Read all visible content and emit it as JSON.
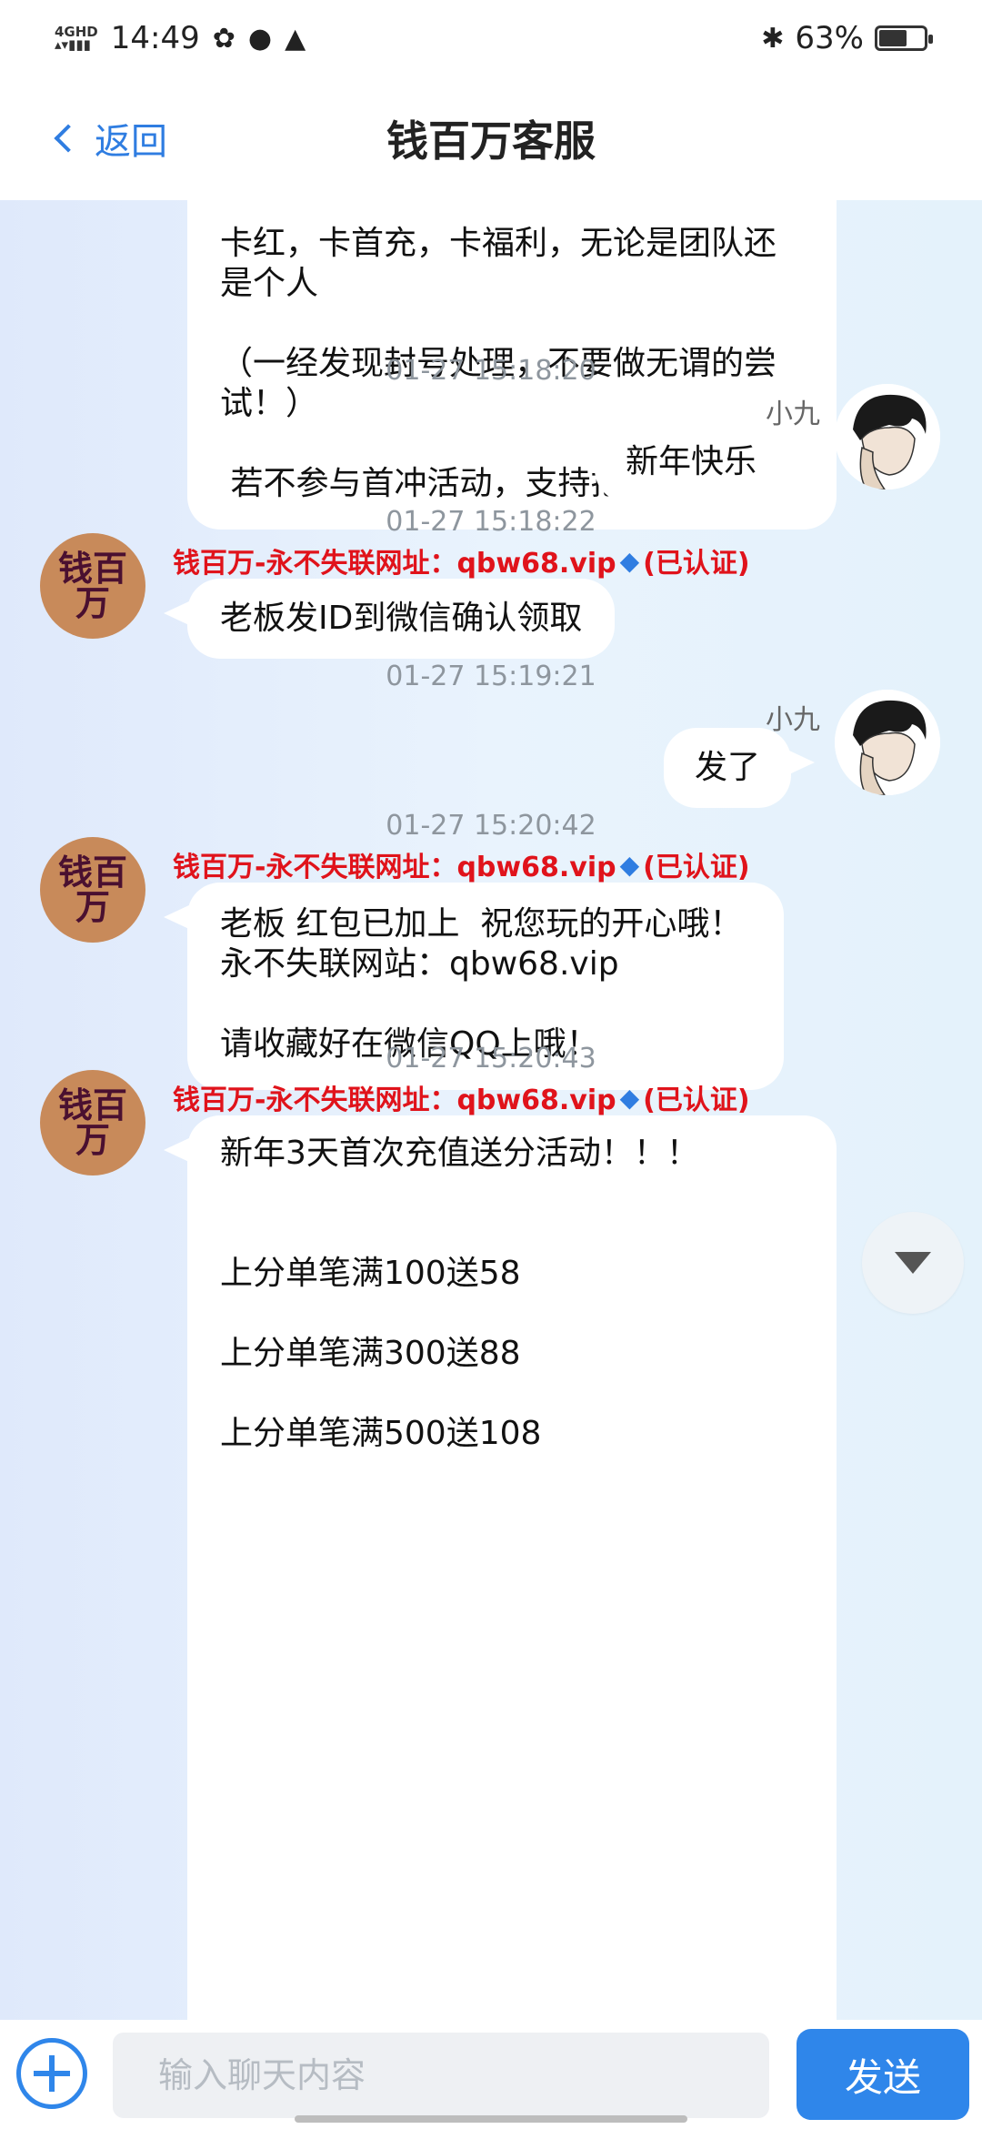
{
  "status_bar": {
    "network_top": "4GHD",
    "network_bottom": "",
    "time": "14:49",
    "battery": "63%",
    "battery_level": 0.63
  },
  "header": {
    "back_label": "返回",
    "title": "钱百万客服"
  },
  "bot": {
    "avatar_text": "钱百万",
    "sender_name": "钱百万-永不失联网址：qbw68.vip",
    "verified_label": "(已认证)"
  },
  "user": {
    "name": "小九"
  },
  "messages": {
    "m0": {
      "lines": [
        "卡红，卡首充，卡福利，无论是团队还",
        "是个人",
        "",
        "（一经发现封号处理，不要做无谓的尝",
        "试！）",
        "",
        " 若不参与首冲活动，支持把把结账"
      ]
    },
    "m1": {
      "time": "01-27 15:18:20",
      "text": "新年快乐"
    },
    "m2": {
      "time": "01-27 15:18:22",
      "text": "老板发ID到微信确认领取"
    },
    "m3": {
      "time": "01-27 15:19:21",
      "text": "发了"
    },
    "m4": {
      "time": "01-27 15:20:42",
      "lines": [
        "老板 红包已加上  祝您玩的开心哦！",
        "永不失联网站：qbw68.vip",
        "",
        "请收藏好在微信QQ上哦！"
      ]
    },
    "m5": {
      "time": "01-27 15:20:43",
      "lines": [
        "新年3天首次充值送分活动！！！",
        "",
        "",
        "上分单笔满100送58",
        "",
        "上分单笔满300送88",
        "",
        "上分单笔满500送108"
      ]
    }
  },
  "input_bar": {
    "placeholder": "输入聊天内容",
    "send_label": "发送"
  }
}
